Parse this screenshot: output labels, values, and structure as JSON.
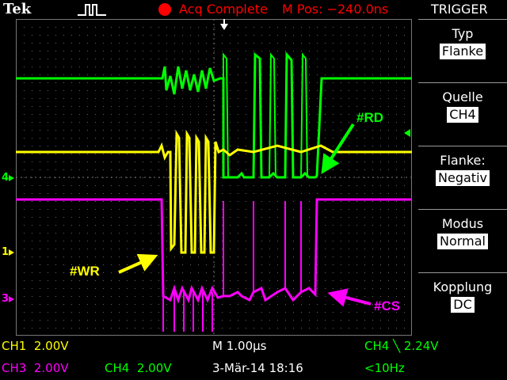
{
  "header": {
    "brand": "Tek",
    "acq_status": "Acq Complete",
    "m_pos": "M Pos: −240.0ns",
    "menu_title": "TRIGGER"
  },
  "menu": [
    {
      "label": "Typ",
      "value": "Flanke"
    },
    {
      "label": "Quelle",
      "value": "CH4"
    },
    {
      "label": "Flanke:",
      "value": "Negativ"
    },
    {
      "label": "Modus",
      "value": "Normal"
    },
    {
      "label": "Kopplung",
      "value": "DC"
    }
  ],
  "markers": {
    "ch4": "4",
    "ch1": "1",
    "ch3": "3"
  },
  "annotations": {
    "rd": "#RD",
    "wr": "#WR",
    "cs": "#CS"
  },
  "status": {
    "ch1": "CH1  2.00V",
    "ch3": "CH3  2.00V",
    "ch4": "CH4  2.00V",
    "timebase": "M 1.00µs",
    "date": "3-Mär-14 18:16",
    "trigger": "CH4 ╲ 2.24V",
    "freq": "<10Hz"
  },
  "colors": {
    "ch1": "#ffff00",
    "ch3": "#ff00ff",
    "ch4": "#00ff00",
    "acq": "#ff0000",
    "annotation_arrow": "#ff0000"
  },
  "icons": {
    "acq_mode": "pulse-icon",
    "trigger_position": "trigger-position-arrow-icon"
  }
}
